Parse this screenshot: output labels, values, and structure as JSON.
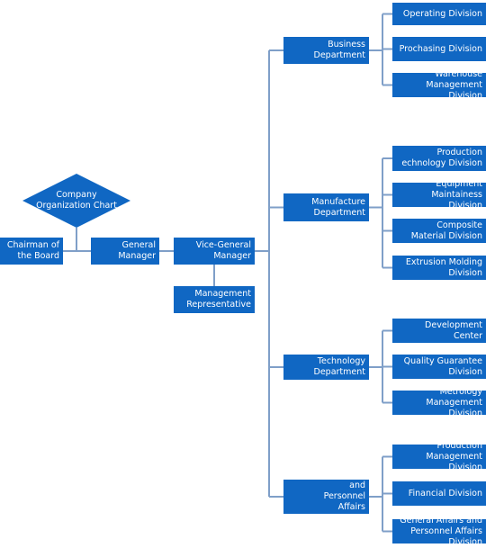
{
  "title": "Company Organization Chart",
  "colors": {
    "box": "#1067c3",
    "text": "#ffffff",
    "connector": "#7f9fc8"
  },
  "root": {
    "label": "Company\nOrganization Chart"
  },
  "executives": [
    {
      "id": "chairman",
      "label": "Chairman of\nthe Board"
    },
    {
      "id": "general-manager",
      "label": "General\nManager"
    },
    {
      "id": "vice-general-manager",
      "label": "Vice-General\nManager"
    },
    {
      "id": "management-representative",
      "label": "Management\nRepresentative"
    }
  ],
  "departments": [
    {
      "id": "business",
      "label": "Business\nDepartment",
      "divisions": [
        "Operating Division",
        "Prochasing Division",
        "Warehouse\nManagement Division"
      ]
    },
    {
      "id": "manufacture",
      "label": "Manufacture\nDepartment",
      "divisions": [
        "Production\nechnology Division",
        "Equipment\nMaintainess Division",
        "Composite\nMaterial Division",
        "Extrusion Molding\nDivision"
      ]
    },
    {
      "id": "technology",
      "label": "Technology\nDepartment",
      "divisions": [
        "Development Center",
        "Quality Guarantee\nDivision",
        "Metrology\nManagement Division"
      ]
    },
    {
      "id": "general-affairs",
      "label": "Genera Affairs and\nPersonnel\nAffairs Department",
      "divisions": [
        "Production\nManagement Division",
        "Financial Division",
        "General Affairs and\nPersonnel Affairs Division"
      ]
    }
  ]
}
